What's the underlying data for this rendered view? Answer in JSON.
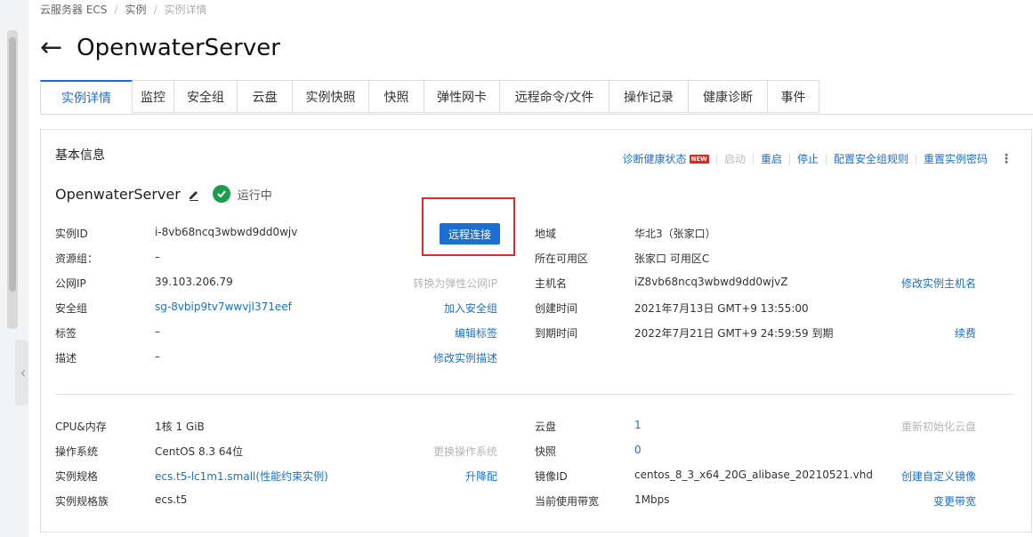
{
  "breadcrumb": {
    "items": [
      "云服务器 ECS",
      "实例",
      "实例详情"
    ]
  },
  "page": {
    "title": "OpenwaterServer",
    "back_icon": "arrow-left-icon"
  },
  "tabs": [
    {
      "label": "实例详情",
      "active": true
    },
    {
      "label": "监控"
    },
    {
      "label": "安全组"
    },
    {
      "label": "云盘"
    },
    {
      "label": "实例快照"
    },
    {
      "label": "快照"
    },
    {
      "label": "弹性网卡"
    },
    {
      "label": "远程命令/文件"
    },
    {
      "label": "操作记录"
    },
    {
      "label": "健康诊断"
    },
    {
      "label": "事件"
    }
  ],
  "card": {
    "title": "基本信息",
    "actions": {
      "diagnose": "诊断健康状态",
      "new_badge": "NEW",
      "start": "启动",
      "restart": "重启",
      "stop": "停止",
      "config_sg": "配置安全组规则",
      "reset_pwd": "重置实例密码"
    },
    "instance_name": "OpenwaterServer",
    "status": "运行中",
    "connect_button": "远程连接",
    "left": {
      "instance_id": {
        "label": "实例ID",
        "value": "i-8vb68ncq3wbwd9dd0wjv"
      },
      "resource_group": {
        "label": "资源组：",
        "value": "–"
      },
      "public_ip": {
        "label": "公网IP",
        "value": "39.103.206.79",
        "action": "转换为弹性公网IP"
      },
      "security_group": {
        "label": "安全组",
        "value": "sg-8vbip9tv7wwvjl371eef",
        "action": "加入安全组"
      },
      "tags": {
        "label": "标签",
        "value": "–",
        "action": "编辑标签"
      },
      "description": {
        "label": "描述",
        "value": "–",
        "action": "修改实例描述"
      }
    },
    "right": {
      "region": {
        "label": "地域",
        "value": "华北3（张家口）"
      },
      "zone": {
        "label": "所在可用区",
        "value": "张家口 可用区C"
      },
      "hostname": {
        "label": "主机名",
        "value": "iZ8vb68ncq3wbwd9dd0wjvZ",
        "action": "修改实例主机名"
      },
      "created": {
        "label": "创建时间",
        "value": "2021年7月13日 GMT+9 13:55:00"
      },
      "expires": {
        "label": "到期时间",
        "value": "2022年7月21日 GMT+9 24:59:59 到期",
        "action": "续费"
      }
    },
    "spec_left": {
      "cpu_mem": {
        "label": "CPU&内存",
        "value": "1核 1 GiB"
      },
      "os": {
        "label": "操作系统",
        "value": "CentOS 8.3 64位",
        "action": "更换操作系统"
      },
      "type": {
        "label": "实例规格",
        "value": "ecs.t5-lc1m1.small(性能约束实例)",
        "action": "升降配"
      },
      "family": {
        "label": "实例规格族",
        "value": "ecs.t5"
      }
    },
    "spec_right": {
      "disk": {
        "label": "云盘",
        "value": "1",
        "action": "重新初始化云盘"
      },
      "snapshot": {
        "label": "快照",
        "value": "0"
      },
      "image": {
        "label": "镜像ID",
        "value": "centos_8_3_x64_20G_alibase_20210521.vhd",
        "action": "创建自定义镜像"
      },
      "bandwidth": {
        "label": "当前使用带宽",
        "value": "1Mbps",
        "action": "变更带宽"
      }
    }
  },
  "colors": {
    "primary": "#1b6fd3",
    "success": "#1a9e4d",
    "highlight": "#e02a2a"
  }
}
